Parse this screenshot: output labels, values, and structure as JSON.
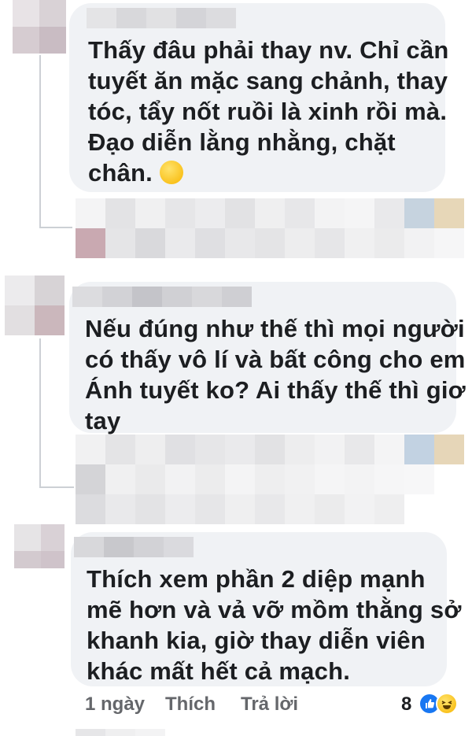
{
  "comments": [
    {
      "text_lines": [
        "Thấy đâu phải thay nv. Chỉ cần",
        "tuyết ăn mặc sang chảnh, thay",
        "tóc, tẩy nốt ruồi là xinh rồi mà.",
        "Đạo diễn lằng nhằng, chặt",
        "chân."
      ],
      "emoji": "rolling-on-floor-laughing-emoji"
    },
    {
      "text_lines": [
        "Nếu đúng như thế thì mọi người",
        "có thấy vô lí và bất công cho em",
        "Ánh tuyết ko? Ai thấy thế thì giơ",
        "tay"
      ]
    },
    {
      "text_lines": [
        "Thích xem phần 2 diệp mạnh",
        "mẽ hơn và vả vỡ mồm thằng sở",
        "khanh kia, giờ thay diễn viên",
        "khác mất hết cả mạch."
      ],
      "footer": {
        "time": "1 ngày",
        "like": "Thích",
        "reply": "Trả lời",
        "reaction_count": "8",
        "reactions": [
          "like-icon",
          "haha-icon"
        ]
      }
    }
  ],
  "colors": {
    "bubble": "#f0f2f5",
    "text": "#1c1e21",
    "secondary": "#65676b",
    "like_blue": "#1877f2",
    "haha_yellow": "#f7b500"
  }
}
